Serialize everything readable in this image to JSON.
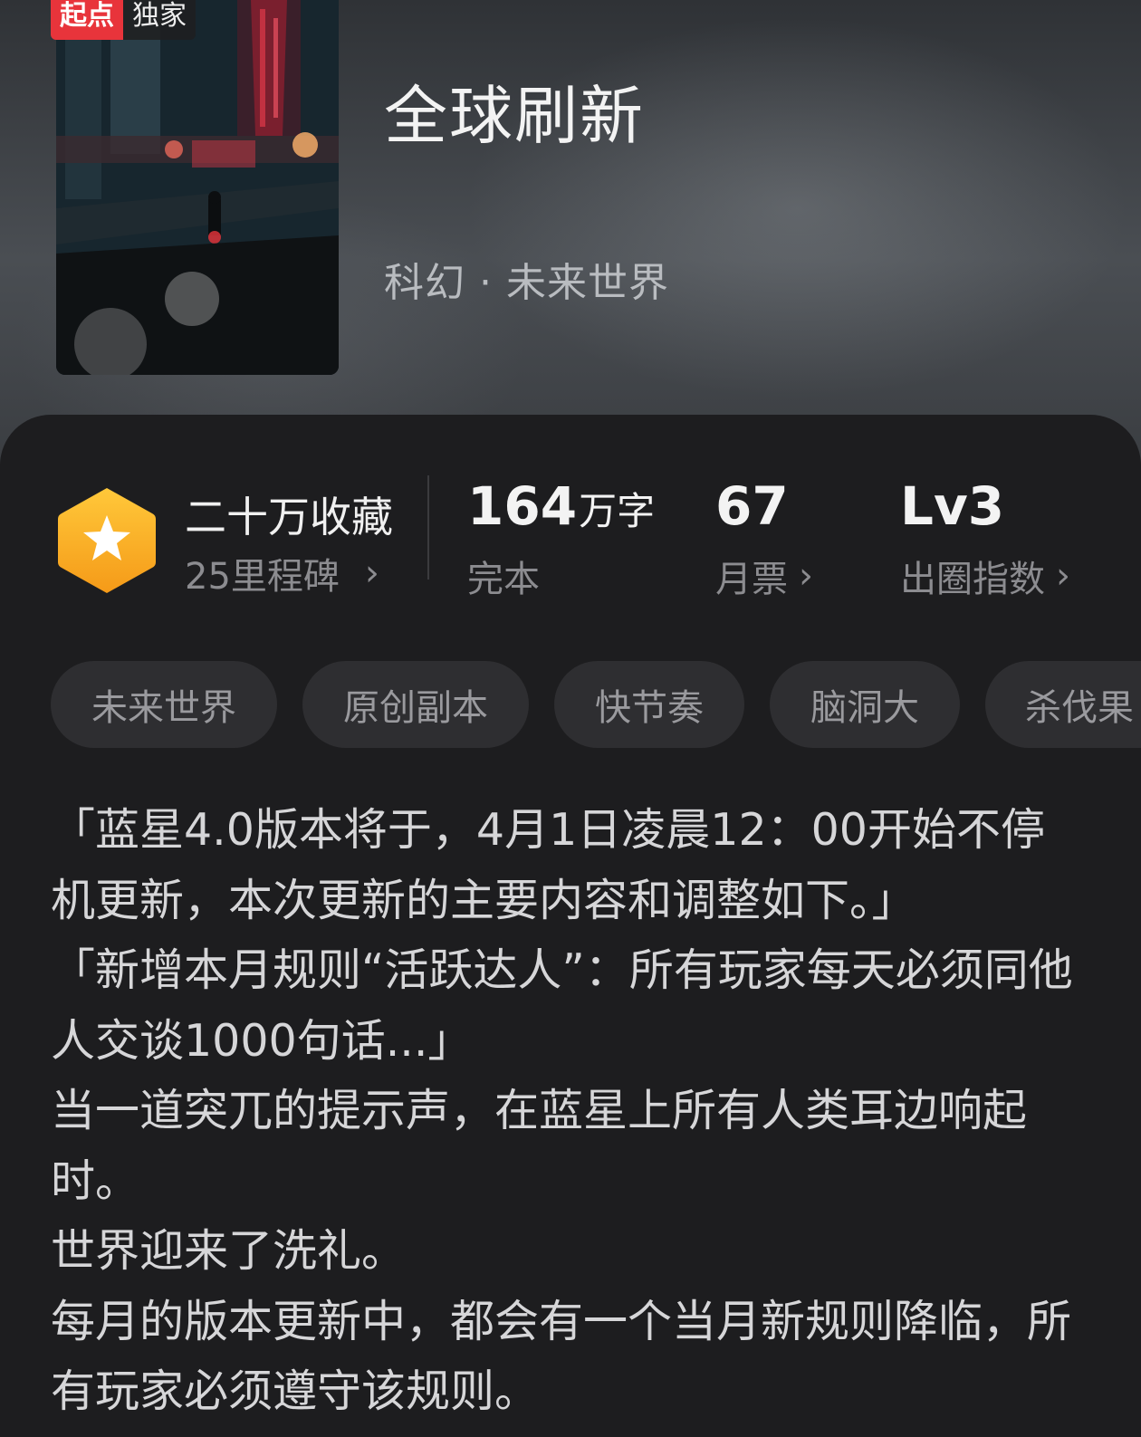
{
  "book": {
    "badge_primary": "起点",
    "badge_secondary": "独家",
    "title": "全球刷新",
    "category": "科幻 · 未来世界"
  },
  "stats": {
    "favorites": {
      "title": "二十万收藏",
      "subtitle": "25里程碑",
      "icon": "star-hexagon-icon"
    },
    "words": {
      "value": "164",
      "unit": "万字",
      "label": "完本"
    },
    "monthly_votes": {
      "value": "67",
      "label": "月票"
    },
    "popularity": {
      "value": "Lv3",
      "label": "出圈指数"
    }
  },
  "tags": [
    "未来世界",
    "原创副本",
    "快节奏",
    "脑洞大",
    "杀伐果"
  ],
  "description": [
    "「蓝星4.0版本将于，4月1日凌晨12：00开始不停机更新，本次更新的主要内容和调整如下。」",
    "「新增本月规则“活跃达人”：所有玩家每天必须同他人交谈1000句话...」",
    "当一道突兀的提示声，在蓝星上所有人类耳边响起时。",
    "世界迎来了洗礼。",
    "每月的版本更新中，都会有一个当月新规则降临，所有玩家必须遵守该规则。"
  ],
  "colors": {
    "accent_red": "#e8343b",
    "hex_gold": "#f5a623",
    "background": "#1d1d1f"
  }
}
